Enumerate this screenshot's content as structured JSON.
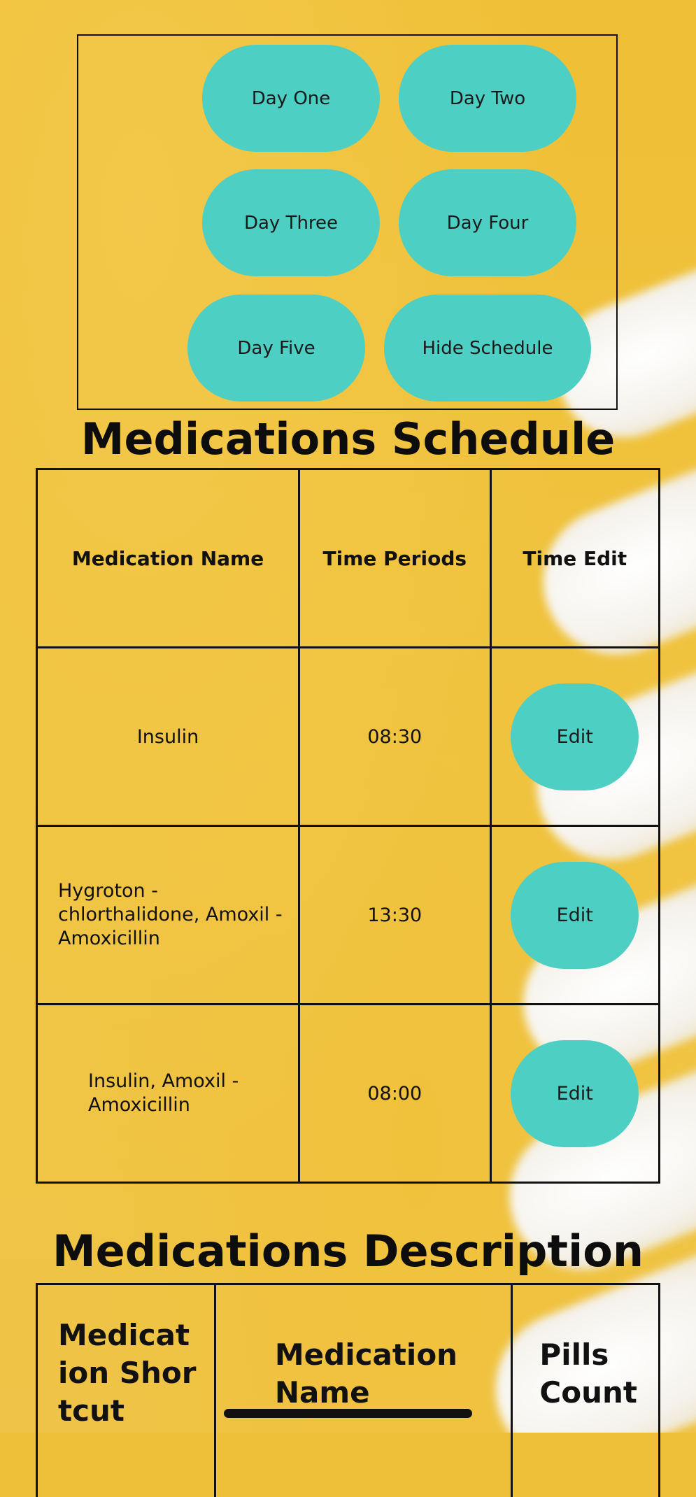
{
  "day_buttons": {
    "day_one": "Day One",
    "day_two": "Day Two",
    "day_three": "Day Three",
    "day_four": "Day Four",
    "day_five": "Day Five",
    "hide_schedule": "Hide Schedule"
  },
  "schedule": {
    "title": "Medications Schedule",
    "headers": [
      "Medication Name",
      "Time Periods",
      "Time Edit"
    ],
    "rows": [
      {
        "name": "Insulin",
        "time": "08:30",
        "action": "Edit"
      },
      {
        "name": "Hygroton - chlorthalidone, Amoxil - Amoxicillin",
        "time": "13:30",
        "action": "Edit"
      },
      {
        "name": "Insulin, Amoxil  - Amoxicillin",
        "time": "08:00",
        "action": "Edit"
      }
    ]
  },
  "description": {
    "title": "Medications Description",
    "headers": [
      "Medication Shortcut",
      "Medication Name",
      "Pills Count"
    ]
  },
  "colors": {
    "background": "#eec03a",
    "button": "#4ecfc4",
    "text": "#111111"
  }
}
